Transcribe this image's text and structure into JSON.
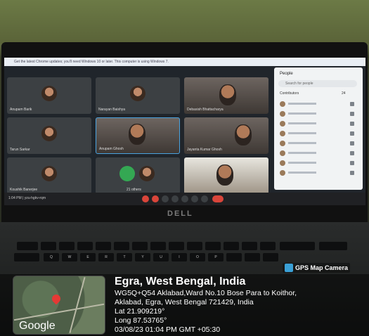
{
  "screen": {
    "banner": "Get the latest Chrome updates; you'll need Windows 10 or later. This computer is using Windows 7.",
    "participants": [
      "Anupam Barik",
      "Narayan Baishya",
      "Debasish Bhattacharya",
      "Tarun Sarkar",
      "Anupam Ghosh",
      "Jayanta Kumar Ghosh",
      "Koushik Banerjee",
      "21 others",
      ""
    ],
    "time": "1:04 PM | yzu-hgkv-rqm",
    "people_title": "People",
    "search_placeholder": "Search for people",
    "contributors": "Contributors",
    "contributors_count": "24"
  },
  "laptop_brand": "DELL",
  "gps": {
    "badge": "GPS Map Camera",
    "city": "Egra, West Bengal, India",
    "address_1": "WG5Q+Q54 Aklabad,Ward No.10 Bose Para to Koithor,",
    "address_2": "Aklabad, Egra, West Bengal 721429, India",
    "lat": "Lat 21.909219°",
    "long": "Long 87.53765°",
    "datetime": "03/08/23 01:04 PM GMT +05:30",
    "map_label": "Google"
  },
  "keys": [
    "Q",
    "W",
    "E",
    "R",
    "T",
    "Y",
    "U",
    "I",
    "O",
    "P"
  ]
}
